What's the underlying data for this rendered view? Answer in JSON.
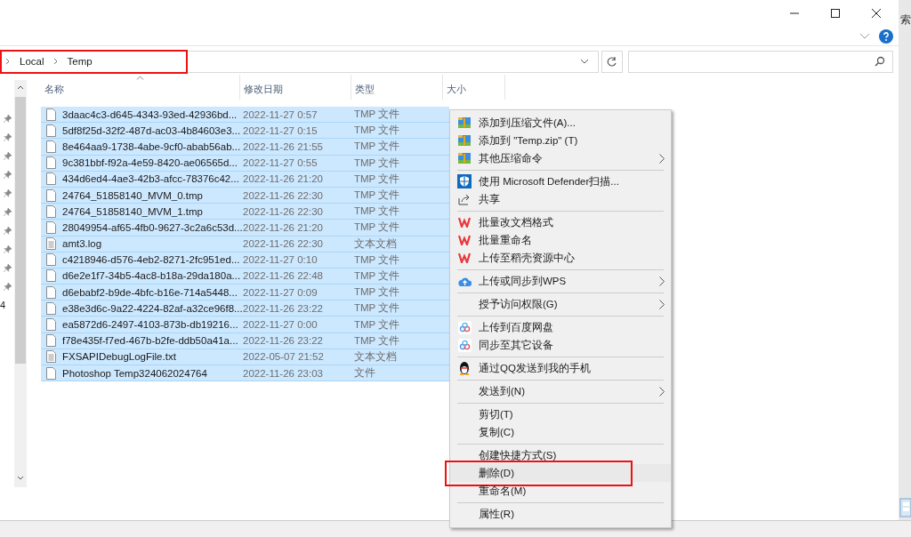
{
  "side_fragment": {
    "text": "索"
  },
  "left_fragment": {
    "text": "4"
  },
  "address_bar": {
    "path": [
      "Local",
      "Temp"
    ],
    "highlighted": true
  },
  "table": {
    "columns": [
      {
        "label": "名称",
        "sorted": true
      },
      {
        "label": "修改日期",
        "sorted": false
      },
      {
        "label": "类型",
        "sorted": false
      },
      {
        "label": "大小",
        "sorted": false
      }
    ],
    "rows": [
      {
        "name": "3daac4c3-d645-4343-93ed-42936bd...",
        "date": "2022-11-27 0:57",
        "type": "TMP 文件",
        "kind": "file",
        "selected": true
      },
      {
        "name": "5df8f25d-32f2-487d-ac03-4b84603e3...",
        "date": "2022-11-27 0:15",
        "type": "TMP 文件",
        "kind": "file",
        "selected": true
      },
      {
        "name": "8e464aa9-1738-4abe-9cf0-abab56ab...",
        "date": "2022-11-26 21:55",
        "type": "TMP 文件",
        "kind": "file",
        "selected": true
      },
      {
        "name": "9c381bbf-f92a-4e59-8420-ae06565d...",
        "date": "2022-11-27 0:55",
        "type": "TMP 文件",
        "kind": "file",
        "selected": true
      },
      {
        "name": "434d6ed4-4ae3-42b3-afcc-78376c42...",
        "date": "2022-11-26 21:20",
        "type": "TMP 文件",
        "kind": "file",
        "selected": true
      },
      {
        "name": "24764_51858140_MVM_0.tmp",
        "date": "2022-11-26 22:30",
        "type": "TMP 文件",
        "kind": "file",
        "selected": true
      },
      {
        "name": "24764_51858140_MVM_1.tmp",
        "date": "2022-11-26 22:30",
        "type": "TMP 文件",
        "kind": "file",
        "selected": true
      },
      {
        "name": "28049954-af65-4fb0-9627-3c2a6c53d...",
        "date": "2022-11-26 21:20",
        "type": "TMP 文件",
        "kind": "file",
        "selected": true
      },
      {
        "name": "amt3.log",
        "date": "2022-11-26 22:30",
        "type": "文本文档",
        "kind": "text",
        "selected": true
      },
      {
        "name": "c4218946-d576-4eb2-8271-2fc951ed...",
        "date": "2022-11-27 0:10",
        "type": "TMP 文件",
        "kind": "file",
        "selected": true
      },
      {
        "name": "d6e2e1f7-34b5-4ac8-b18a-29da180a...",
        "date": "2022-11-26 22:48",
        "type": "TMP 文件",
        "kind": "file",
        "selected": true
      },
      {
        "name": "d6ebabf2-b9de-4bfc-b16e-714a5448...",
        "date": "2022-11-27 0:09",
        "type": "TMP 文件",
        "kind": "file",
        "selected": true
      },
      {
        "name": "e38e3d6c-9a22-4224-82af-a32ce96f8...",
        "date": "2022-11-26 23:22",
        "type": "TMP 文件",
        "kind": "file",
        "selected": true
      },
      {
        "name": "ea5872d6-2497-4103-873b-db19216...",
        "date": "2022-11-27 0:00",
        "type": "TMP 文件",
        "kind": "file",
        "selected": true
      },
      {
        "name": "f78e435f-f7ed-467b-b2fe-ddb50a41a...",
        "date": "2022-11-26 23:22",
        "type": "TMP 文件",
        "kind": "file",
        "selected": true
      },
      {
        "name": "FXSAPIDebugLogFile.txt",
        "date": "2022-05-07 21:52",
        "type": "文本文档",
        "kind": "text",
        "selected": true
      },
      {
        "name": "Photoshop Temp324062024764",
        "date": "2022-11-26 23:03",
        "type": "文件",
        "kind": "file",
        "selected": true
      }
    ]
  },
  "context_menu": {
    "items": [
      {
        "kind": "archive",
        "label": "添加到压缩文件(A)...",
        "submenu": false,
        "highlighted": false
      },
      {
        "kind": "archive",
        "label": "添加到 \"Temp.zip\" (T)",
        "submenu": false,
        "highlighted": false
      },
      {
        "kind": "archive",
        "label": "其他压缩命令",
        "submenu": true,
        "highlighted": false
      },
      {
        "kind": "separator"
      },
      {
        "kind": "shield",
        "label": "使用 Microsoft Defender扫描...",
        "submenu": false,
        "highlighted": false
      },
      {
        "kind": "share",
        "label": "共享",
        "submenu": false,
        "highlighted": false
      },
      {
        "kind": "separator"
      },
      {
        "kind": "wps",
        "label": "批量改文档格式",
        "submenu": false,
        "highlighted": false
      },
      {
        "kind": "wps",
        "label": "批量重命名",
        "submenu": false,
        "highlighted": false
      },
      {
        "kind": "wps",
        "label": "上传至稻壳资源中心",
        "submenu": false,
        "highlighted": false
      },
      {
        "kind": "separator"
      },
      {
        "kind": "cloud",
        "label": "上传或同步到WPS",
        "submenu": true,
        "highlighted": false
      },
      {
        "kind": "separator"
      },
      {
        "kind": "plain",
        "label": "授予访问权限(G)",
        "submenu": true,
        "highlighted": false
      },
      {
        "kind": "separator"
      },
      {
        "kind": "drive",
        "label": "上传到百度网盘",
        "submenu": false,
        "highlighted": false
      },
      {
        "kind": "drive",
        "label": "同步至其它设备",
        "submenu": false,
        "highlighted": false
      },
      {
        "kind": "separator"
      },
      {
        "kind": "penguin",
        "label": "通过QQ发送到我的手机",
        "submenu": false,
        "highlighted": false
      },
      {
        "kind": "separator"
      },
      {
        "kind": "plain",
        "label": "发送到(N)",
        "submenu": true,
        "highlighted": false
      },
      {
        "kind": "separator"
      },
      {
        "kind": "plain",
        "label": "剪切(T)",
        "submenu": false,
        "highlighted": false
      },
      {
        "kind": "plain",
        "label": "复制(C)",
        "submenu": false,
        "highlighted": false
      },
      {
        "kind": "separator"
      },
      {
        "kind": "plain",
        "label": "创建快捷方式(S)",
        "submenu": false,
        "highlighted": false
      },
      {
        "kind": "plain",
        "label": "删除(D)",
        "submenu": false,
        "highlighted": true
      },
      {
        "kind": "plain",
        "label": "重命名(M)",
        "submenu": false,
        "highlighted": false
      },
      {
        "kind": "separator"
      },
      {
        "kind": "plain",
        "label": "属性(R)",
        "submenu": false,
        "highlighted": false
      }
    ]
  }
}
